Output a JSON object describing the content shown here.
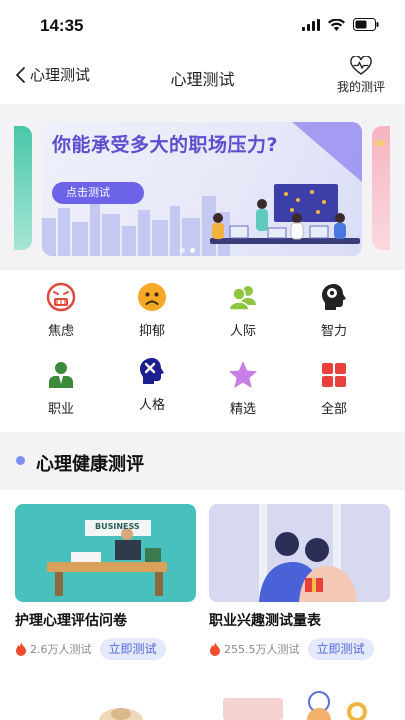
{
  "status_bar": {
    "time": "14:35"
  },
  "nav": {
    "back_label": "心理测试",
    "title": "心理测试",
    "my_eval_label": "我的测评"
  },
  "banner": {
    "title": "你能承受多大的职场压力?",
    "button_label": "点击测试",
    "peek_right_text": "",
    "colors": {
      "accent": "#6c63e8",
      "title": "#5b4fd0"
    }
  },
  "categories": [
    {
      "label": "焦虑",
      "icon": "anxious-face-icon"
    },
    {
      "label": "抑郁",
      "icon": "sad-face-icon"
    },
    {
      "label": "人际",
      "icon": "people-icon"
    },
    {
      "label": "智力",
      "icon": "brain-head-icon"
    },
    {
      "label": "职业",
      "icon": "business-person-icon"
    },
    {
      "label": "人格",
      "icon": "head-x-icon"
    },
    {
      "label": "精选",
      "icon": "star-icon"
    },
    {
      "label": "全部",
      "icon": "grid-icon"
    }
  ],
  "section": {
    "title": "心理健康测评"
  },
  "cards": [
    {
      "title": "护理心理评估问卷",
      "count": "2.6万人测试",
      "button": "立即测试",
      "image_text": "BUSINESS"
    },
    {
      "title": "职业兴趣测试量表",
      "count": "255.5万人测试",
      "button": "立即测试"
    }
  ]
}
